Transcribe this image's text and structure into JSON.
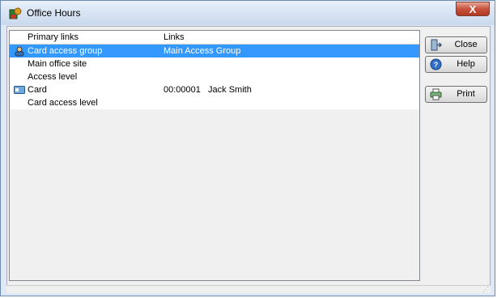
{
  "window": {
    "title": "Office Hours",
    "close_glyph": "X"
  },
  "list": {
    "headers": [
      "Primary links",
      "Links"
    ],
    "rows": [
      {
        "primary": "Card access group",
        "links": "Main Access Group",
        "selected": true,
        "icon": "access-group-icon"
      },
      {
        "primary": "Main office site",
        "links": ""
      },
      {
        "primary": "Access level",
        "links": ""
      },
      {
        "primary": "Card",
        "links": "00:00001   Jack Smith",
        "icon": "card-icon"
      },
      {
        "primary": "Card access level",
        "links": ""
      }
    ]
  },
  "buttons": {
    "close": {
      "label": "Close",
      "icon": "door-exit-icon"
    },
    "help": {
      "label": "Help",
      "icon": "help-icon"
    },
    "print": {
      "label": "Print",
      "icon": "printer-icon"
    }
  },
  "colors": {
    "selection": "#3399ff",
    "close_button": "#c7513c"
  }
}
